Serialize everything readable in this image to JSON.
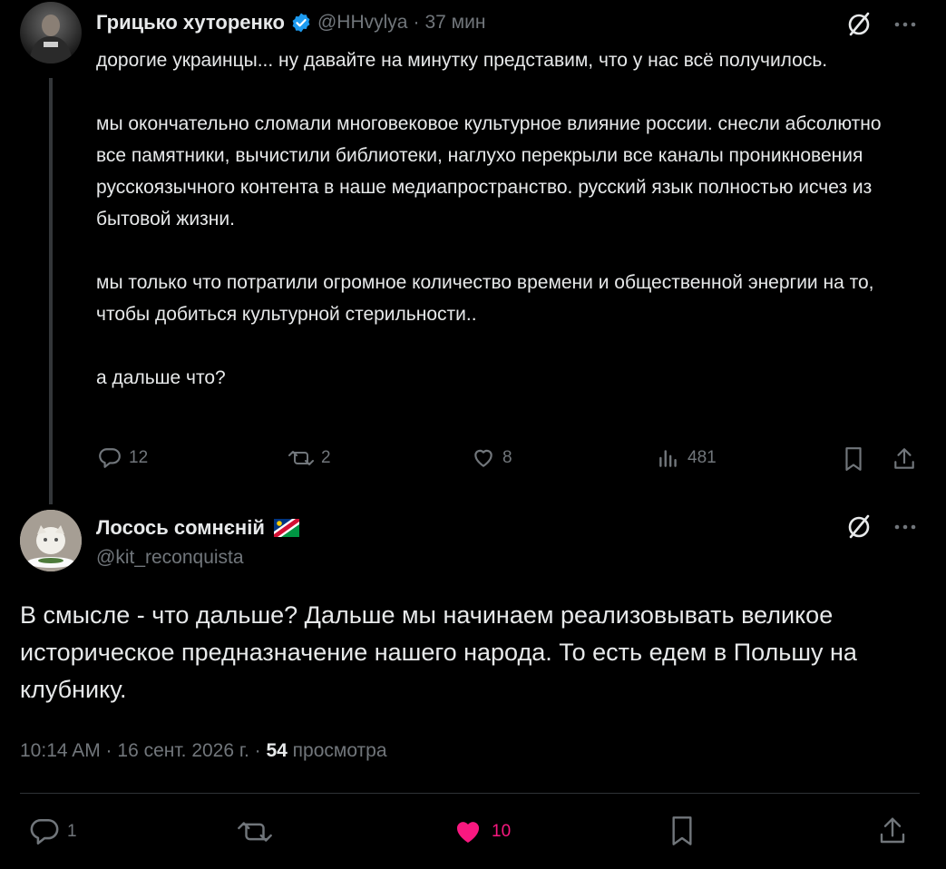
{
  "tweet1": {
    "author": "Грицько хуторенко",
    "handle": "@HHvylya",
    "separator": "·",
    "time": "37 мин",
    "paragraphs": [
      "дорогие украинцы... ну давайте на минутку представим, что у нас всё получилось.",
      "мы окончательно сломали многовековое культурное влияние россии. снесли абсолютно все памятники, вычистили библиотеки, наглухо перекрыли все каналы проникновения русскоязычного контента в наше медиапространство. русский язык полностью исчез из бытовой жизни.",
      "мы только что потратили огромное количество времени и общественной энергии на то, чтобы добиться культурной стерильности..",
      "а дальше что?"
    ],
    "replies": "12",
    "reposts": "2",
    "likes": "8",
    "views": "481"
  },
  "tweet2": {
    "author": "Лосось сомнєнiй",
    "handle": "@kit_reconquista",
    "text": "В смысле - что дальше? Дальше мы начинаем реализовывать великое историческое предназначение нашего народа. То есть едем в Польшу на клубнику.",
    "meta_time": "10:14 AM · 16 сент. 2026 г. · ",
    "views_count": "54",
    "views_label": " просмотра",
    "replies": "1",
    "likes": "10"
  },
  "colors": {
    "verified": "#1d9bf0",
    "like_active": "#f91880",
    "muted": "#71767b",
    "text": "#e7e9ea"
  },
  "icons": [
    "verified-badge-icon",
    "grok-slash-icon",
    "more-icon",
    "reply-icon",
    "repost-icon",
    "like-icon",
    "views-icon",
    "bookmark-icon",
    "share-icon",
    "flag-icon"
  ]
}
